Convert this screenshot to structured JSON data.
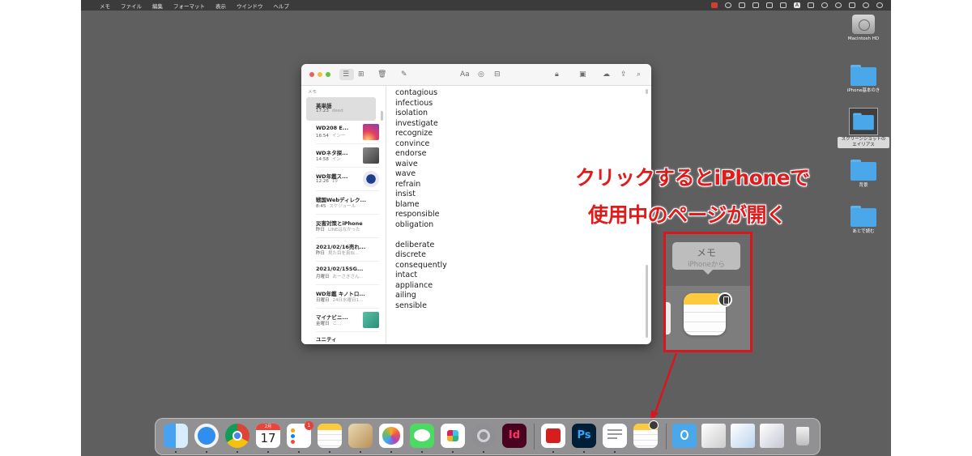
{
  "menubar": {
    "apple": "",
    "items": [
      "メモ",
      "ファイル",
      "編集",
      "フォーマット",
      "表示",
      "ウインドウ",
      "ヘルプ"
    ],
    "input_source": "A"
  },
  "desktop": {
    "icons": [
      {
        "label": "Macintosh HD",
        "kind": "drive"
      },
      {
        "label": "iPhone基本のき",
        "kind": "folder"
      },
      {
        "label": "スクリーンショットのエイリアス",
        "kind": "alias"
      },
      {
        "label": "背景",
        "kind": "folder"
      },
      {
        "label": "あとで読む",
        "kind": "folder"
      }
    ]
  },
  "notes_window": {
    "sidebar_header": "メモ",
    "notes": [
      {
        "title": "英単語",
        "time": "17:23",
        "preview": "deed",
        "selected": true,
        "thumb": null
      },
      {
        "title": "WD208 E...",
        "time": "16:54",
        "preview": "インー",
        "selected": false,
        "thumb": "instagram"
      },
      {
        "title": "WDネタ探...",
        "time": "14:58",
        "preview": "イン",
        "selected": false,
        "thumb": "photo"
      },
      {
        "title": "WD年鑑ス...",
        "time": "12:26",
        "preview": "19",
        "selected": false,
        "thumb": "circle"
      },
      {
        "title": "戦国Webディレク...",
        "time": "8:45",
        "preview": "スケジュール",
        "selected": false,
        "thumb": null
      },
      {
        "title": "災害対策とiPhone",
        "time": "昨日",
        "preview": "LINEはなかった",
        "selected": false,
        "thumb": null
      },
      {
        "title": "2021/02/16売れ...",
        "time": "昨日",
        "preview": "見た目を真似...",
        "selected": false,
        "thumb": null
      },
      {
        "title": "2021/02/15SG...",
        "time": "月曜日",
        "preview": "おーさきさん...",
        "selected": false,
        "thumb": null
      },
      {
        "title": "WD年鑑 キノトロ...",
        "time": "日曜日",
        "preview": "24日水曜日1...",
        "selected": false,
        "thumb": null
      },
      {
        "title": "マイナビニ...",
        "time": "金曜日",
        "preview": "こ...",
        "selected": false,
        "thumb": "green"
      },
      {
        "title": "ユニティ",
        "time": "",
        "preview": "",
        "selected": false,
        "thumb": null
      }
    ],
    "toolbar": {
      "font_button": "Aa"
    },
    "words_group1": [
      "contagious",
      "infectious",
      "isolation",
      "investigate",
      "recognize",
      "convince",
      "endorse",
      "waive",
      "wave",
      "refrain",
      "insist",
      "blame",
      "responsible",
      "obligation"
    ],
    "words_group2": [
      "deliberate",
      "discrete",
      "consequently",
      "intact",
      "appliance",
      "ailing",
      "sensible"
    ]
  },
  "annotation": {
    "line1": "クリックするとiPhoneで",
    "line2": "使用中のページが開く",
    "tooltip_title": "メモ",
    "tooltip_sub": "iPhoneから"
  },
  "dock": {
    "calendar_month": "2月",
    "calendar_day": "17",
    "reminders_badge": "1",
    "indesign_label": "Id",
    "photoshop_label": "Ps"
  },
  "colors": {
    "accent_red": "#d8161b",
    "folder_blue": "#4aa8ea",
    "notes_yellow": "#fcca3c"
  }
}
